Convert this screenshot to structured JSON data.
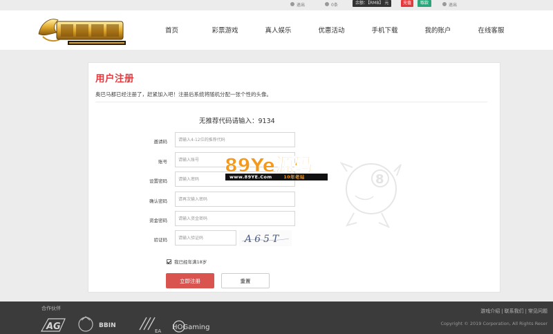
{
  "topbar": {
    "item1": "退出",
    "item2": "0条",
    "balance": "余额：【RMB】 元",
    "deposit": "充值",
    "withdraw": "取款",
    "logout": "退出"
  },
  "nav": {
    "items": [
      "首页",
      "彩票游戏",
      "真人娱乐",
      "优惠活动",
      "手机下载",
      "我的账户",
      "在线客服"
    ]
  },
  "register": {
    "title": "用户注册",
    "description": "奥巴马都已经注册了，赶紧加入吧！注册后系统将随机分配一张个性的头像。",
    "referral_text": "无推荐代码请输入：9134",
    "fields": [
      {
        "label": "邀请码",
        "placeholder": "请输入4-12位的推荐代码"
      },
      {
        "label": "账号",
        "placeholder": "请输入账号"
      },
      {
        "label": "设置密码",
        "placeholder": "请输入密码"
      },
      {
        "label": "确认密码",
        "placeholder": "请再次输入密码"
      },
      {
        "label": "资金密码",
        "placeholder": "请输入资金密码"
      },
      {
        "label": "验证码",
        "placeholder": "请输入验证码"
      }
    ],
    "captcha_text": "A65T",
    "agree_label": "我已经年满18岁",
    "agree_checked": true,
    "submit_label": "立即注册",
    "reset_label": "重置"
  },
  "watermark": {
    "brand": "89Ye源码",
    "url": "www.89YE.Com",
    "tag": "10年老站"
  },
  "footer": {
    "partners_title": "合作伙伴",
    "partners": [
      "AG",
      "BBIN",
      "EA",
      "HOGaming"
    ],
    "links": [
      "游戏介绍",
      "联系我们",
      "常见问题"
    ],
    "copyright": "Copyright © 2019 Corporation, All Rights Reser"
  },
  "colors": {
    "accent_red": "#e4393c",
    "submit_red": "#d9534f",
    "withdraw_green": "#2aa57a",
    "footer_bg": "#3b3b3b",
    "watermark_orange": "#f39a1e"
  }
}
